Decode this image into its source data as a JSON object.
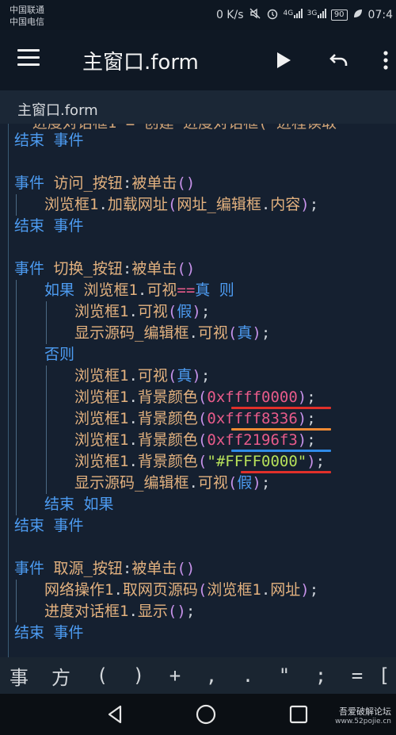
{
  "status_bar": {
    "carrier_1": "中国联通",
    "carrier_2": "中国电信",
    "net_speed": "0 K/s",
    "signal_1_type": "4G",
    "signal_2_type": "3G",
    "battery": "90",
    "time": "07:4"
  },
  "app_bar": {
    "title": "主窗口.form",
    "run_icon": "play-icon",
    "undo_icon": "undo-icon",
    "more_icon": "more-vertical-icon"
  },
  "file_tab": {
    "label": "主窗口.form"
  },
  "code_lines": [
    "结束 事件",
    "",
    "事件 访问_按钮:被单击()",
    "浏览框1.加载网址(网址_编辑框.内容);",
    "结束 事件",
    "",
    "事件 切换_按钮:被单击()",
    "如果 浏览框1.可视==真 则",
    "浏览框1.可视(假);",
    "显示源码_编辑框.可视(真);",
    "否则",
    "浏览框1.可视(真);",
    "浏览框1.背景颜色(0xffff0000);",
    "浏览框1.背景颜色(0xffff8336);",
    "浏览框1.背景颜色(0xff2196f3);",
    "浏览框1.背景颜色(\"#FFFF0000\");",
    "显示源码_编辑框.可视(假);",
    "结束 如果",
    "结束 事件",
    "",
    "事件 取源_按钮:被单击()",
    "网络操作1.取网页源码(浏览框1.网址);",
    "进度对话框1.显示();",
    "结束 事件"
  ],
  "code_tokens": {
    "end": "结束",
    "event": "事件",
    "if": "如果",
    "then": "则",
    "else": "否则",
    "btn_visit": "访问_按钮",
    "btn_switch": "切换_按钮",
    "btn_source": "取源_按钮",
    "clicked": "被单击",
    "browser": "浏览框1",
    "load_url": "加载网址",
    "url_edit": "网址_编辑框",
    "content": "内容",
    "visible": "可视",
    "true": "真",
    "false": "假",
    "src_edit": "显示源码_编辑框",
    "bg_color": "背景颜色",
    "net": "网络操作1",
    "get_src": "取网页源码",
    "url": "网址",
    "progress": "进度对话框1",
    "show": "显示",
    "color_1": "0xffff0000",
    "color_2": "0xffff8336",
    "color_3": "0xff2196f3",
    "color_4": "\"#FFFF0000\""
  },
  "annotation_colors": {
    "line_1": "#e0302a",
    "line_2": "#f08a34",
    "line_3": "#2f8be8",
    "line_4": "#e0302a"
  },
  "symbol_bar": [
    "事",
    "方",
    "(",
    ")",
    "+",
    ",",
    ".",
    "\"",
    ";",
    "=",
    ":",
    "["
  ],
  "nav_bar": {
    "back_icon": "back-triangle-icon",
    "home_icon": "home-circle-icon",
    "recent_icon": "recent-square-icon"
  },
  "watermark": {
    "title": "吾爱破解论坛",
    "url": "www.52pojie.cn"
  }
}
